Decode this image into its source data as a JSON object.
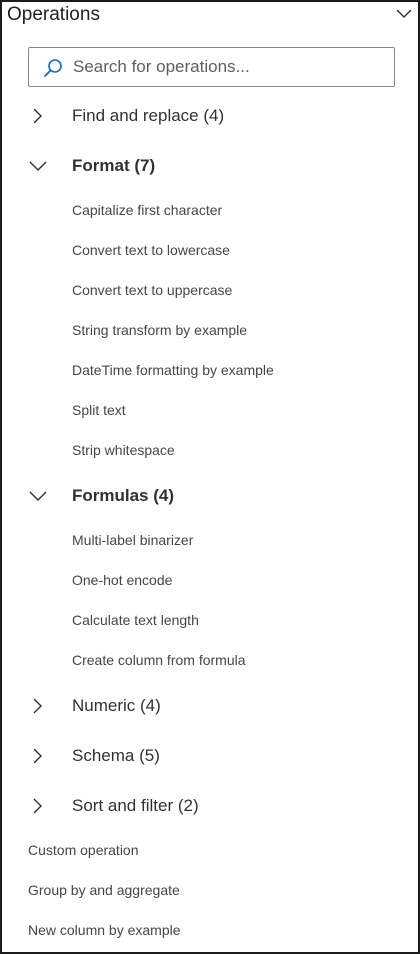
{
  "panel": {
    "title": "Operations",
    "collapse_icon": "chevron-down-icon"
  },
  "search": {
    "placeholder": "Search for operations...",
    "value": "",
    "icon": "search-icon"
  },
  "groups": [
    {
      "label": "Find and replace (4)",
      "expanded": false,
      "items": []
    },
    {
      "label": "Format (7)",
      "expanded": true,
      "items": [
        "Capitalize first character",
        "Convert text to lowercase",
        "Convert text to uppercase",
        "String transform by example",
        "DateTime formatting by example",
        "Split text",
        "Strip whitespace"
      ]
    },
    {
      "label": "Formulas (4)",
      "expanded": true,
      "items": [
        "Multi-label binarizer",
        "One-hot encode",
        "Calculate text length",
        "Create column from formula"
      ]
    },
    {
      "label": "Numeric (4)",
      "expanded": false,
      "items": []
    },
    {
      "label": "Schema (5)",
      "expanded": false,
      "items": []
    },
    {
      "label": "Sort and filter (2)",
      "expanded": false,
      "items": []
    }
  ],
  "standalone": [
    "Custom operation",
    "Group by and aggregate",
    "New column by example"
  ],
  "colors": {
    "border": "#1b1b1b",
    "text": "#323130",
    "subtext": "#484644",
    "accent": "#0f6cbd"
  }
}
